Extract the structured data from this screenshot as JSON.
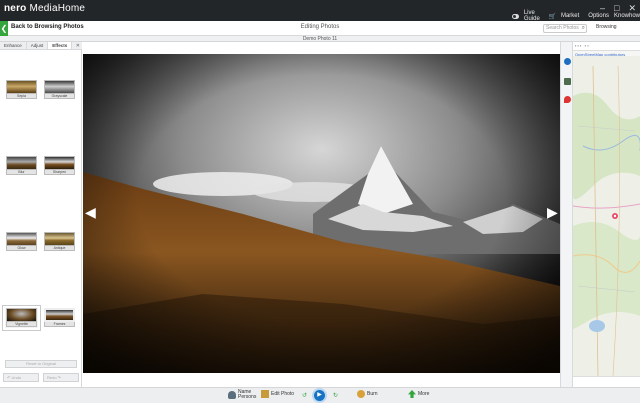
{
  "app": {
    "brand_logo": "nero",
    "brand_name": "MediaHome",
    "live_guide": "Live Guide",
    "market": "Market",
    "options": "Options",
    "knowhow": "Knowhow",
    "window_controls": [
      "–",
      "□",
      "✕"
    ]
  },
  "nav": {
    "back_label": "Back to Browsing Photos",
    "editing_label": "Editing Photos",
    "search_placeholder": "Search Photos",
    "browse_label": "Browsing"
  },
  "file": {
    "name": "Demo Photo 11"
  },
  "left_panel": {
    "tabs": [
      "Enhance",
      "Adjust",
      "Effects"
    ],
    "active_tab": "Effects",
    "effects": [
      {
        "label": "Sepia",
        "tone": "sepia"
      },
      {
        "label": "Grayscale",
        "tone": "gray"
      },
      {
        "label": "Blur",
        "tone": "blur"
      },
      {
        "label": "Sharpen",
        "tone": "sharp"
      },
      {
        "label": "Glow",
        "tone": "glow"
      },
      {
        "label": "Antique",
        "tone": "antique"
      },
      {
        "label": "Vignette",
        "tone": "vignette"
      },
      {
        "label": "Frames",
        "tone": "frames"
      }
    ],
    "selected_effect": "Vignette",
    "reset_label": "Reset to Original",
    "undo_label": "Undo",
    "redo_label": "Redo"
  },
  "map": {
    "credit": "OpenStreetMap contributors"
  },
  "bottom_toolbar": {
    "name_persons": "Name Persons",
    "edit_photo": "Edit Photo",
    "burn": "Burn",
    "more": "More"
  },
  "colors": {
    "accent_green": "#34a43d",
    "titlebar": "#232629",
    "play_blue": "#1673c4"
  }
}
